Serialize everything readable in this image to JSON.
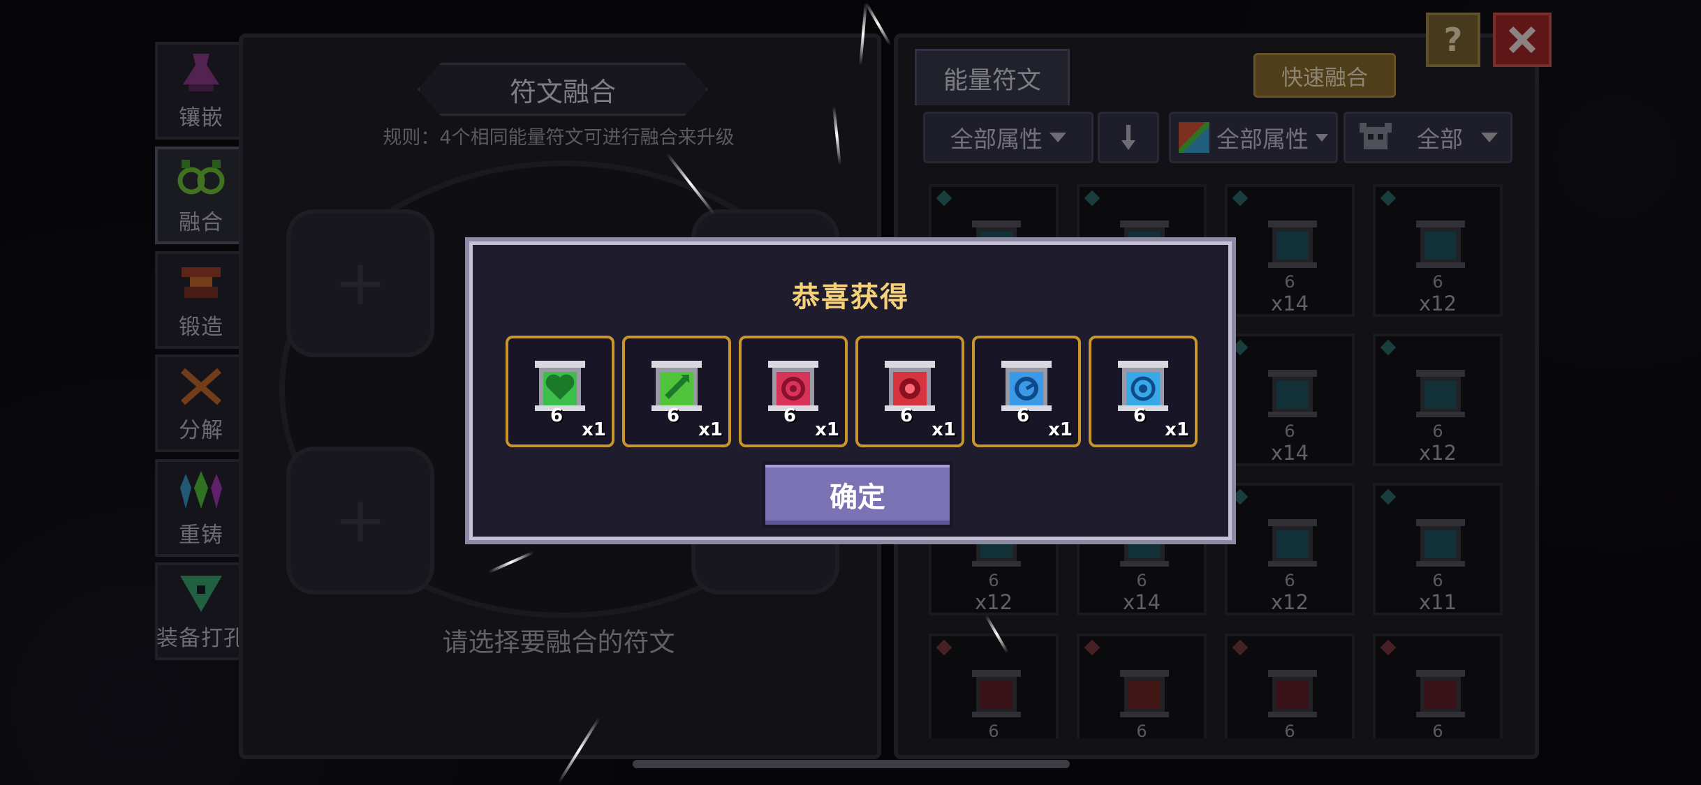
{
  "nav": {
    "items": [
      {
        "label": "镶嵌",
        "icon": "inlay-flask-icon"
      },
      {
        "label": "融合",
        "icon": "fusion-rings-icon",
        "active": true
      },
      {
        "label": "锻造",
        "icon": "forge-anvil-icon"
      },
      {
        "label": "分解",
        "icon": "decompose-icon"
      },
      {
        "label": "重铸",
        "icon": "recast-crystals-icon"
      },
      {
        "label": "装备打孔",
        "icon": "socket-drill-icon"
      }
    ]
  },
  "fusion": {
    "title": "符文融合",
    "rule": "规则：4个相同能量符文可进行融合来升级",
    "hint": "请选择要融合的符文"
  },
  "rune_panel": {
    "tab": "能量符文",
    "quick_fuse": "快速融合",
    "filters": [
      "全部属性",
      "全部属性",
      "全部"
    ],
    "sort_icon": "sort-down-arrow-icon",
    "cells": [
      {
        "level": "",
        "qty": ""
      },
      {
        "level": "",
        "qty": ""
      },
      {
        "level": "6",
        "qty": "x14"
      },
      {
        "level": "6",
        "qty": "x12"
      },
      {
        "level": "",
        "qty": ""
      },
      {
        "level": "",
        "qty": ""
      },
      {
        "level": "6",
        "qty": "x14"
      },
      {
        "level": "6",
        "qty": "x12"
      },
      {
        "level": "6",
        "qty": "x12"
      },
      {
        "level": "6",
        "qty": "x14"
      },
      {
        "level": "6",
        "qty": "x12"
      },
      {
        "level": "6",
        "qty": "x11"
      },
      {
        "level": "6",
        "qty": ""
      },
      {
        "level": "6",
        "qty": ""
      },
      {
        "level": "6",
        "qty": ""
      },
      {
        "level": "6",
        "qty": ""
      }
    ]
  },
  "top_buttons": {
    "help": "?",
    "close_icon": "close-x-icon"
  },
  "modal": {
    "title": "恭喜获得",
    "confirm": "确定",
    "rewards": [
      {
        "level": "6",
        "qty": "x1",
        "color": "#3bbf4a",
        "icon": "green-heart-rune-icon"
      },
      {
        "level": "6",
        "qty": "x1",
        "color": "#52c43c",
        "icon": "green-arrow-rune-icon"
      },
      {
        "level": "6",
        "qty": "x1",
        "color": "#d8345a",
        "icon": "red-swirl-rune-icon"
      },
      {
        "level": "6",
        "qty": "x1",
        "color": "#d83440",
        "icon": "red-orb-rune-icon"
      },
      {
        "level": "6",
        "qty": "x1",
        "color": "#3a9ae8",
        "icon": "blue-swirl-rune-icon"
      },
      {
        "level": "6",
        "qty": "x1",
        "color": "#38a8e6",
        "icon": "blue-target-rune-icon"
      }
    ]
  }
}
